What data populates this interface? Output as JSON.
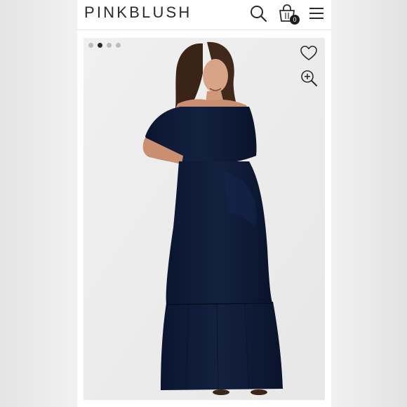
{
  "header": {
    "logo": "PINKBLUSH",
    "cart_count": "0",
    "icons": [
      "search-icon",
      "shopping-bag-icon",
      "hamburger-menu-icon"
    ]
  },
  "gallery": {
    "slide_count": 4,
    "active_slide": 2,
    "actions": [
      "heart-icon",
      "zoom-in-icon"
    ],
    "product_color": "#0f1b36"
  },
  "colors": {
    "logo": "#2b2b2b",
    "badge": "#1d1d1d",
    "background": "#ededed"
  }
}
